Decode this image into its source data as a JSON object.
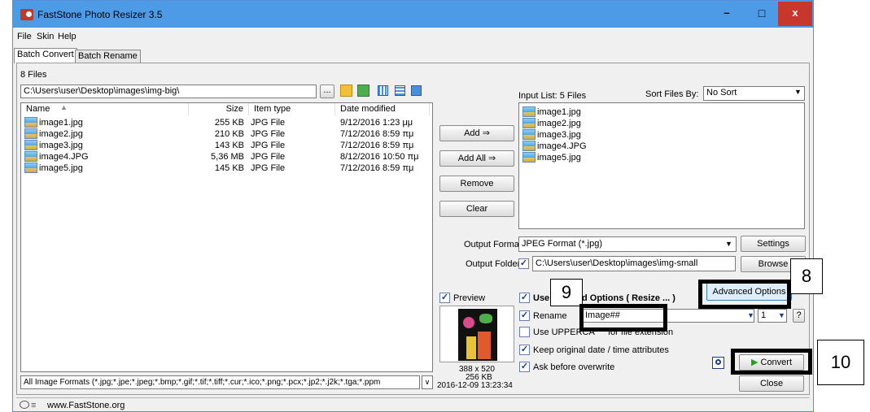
{
  "title": "FastStone Photo Resizer 3.5",
  "window_buttons": {
    "minimize": "–",
    "maximize": "□",
    "close": "x"
  },
  "menu": [
    "File",
    "Skin",
    "Help"
  ],
  "tabs": [
    "Batch Convert",
    "Batch Rename"
  ],
  "file_count": "8 Files",
  "path": "C:\\Users\\user\\Desktop\\images\\img-big\\",
  "browse_dots": "...",
  "columns": {
    "name": "Name",
    "size": "Size",
    "type": "Item type",
    "date": "Date modified"
  },
  "files": [
    {
      "name": "image1.jpg",
      "size": "255 KB",
      "type": "JPG File",
      "date": "9/12/2016 1:23 μμ"
    },
    {
      "name": "image2.jpg",
      "size": "210 KB",
      "type": "JPG File",
      "date": "7/12/2016 8:59 πμ"
    },
    {
      "name": "image3.jpg",
      "size": "143 KB",
      "type": "JPG File",
      "date": "7/12/2016 8:59 πμ"
    },
    {
      "name": "image4.JPG",
      "size": "5,36 MB",
      "type": "JPG File",
      "date": "8/12/2016 10:50 πμ"
    },
    {
      "name": "image5.jpg",
      "size": "145 KB",
      "type": "JPG File",
      "date": "7/12/2016 8:59 πμ"
    }
  ],
  "filter": "All Image Formats (*.jpg;*.jpe;*.jpeg;*.bmp;*.gif;*.tif;*.tiff;*.cur;*.ico;*.png;*.pcx;*.jp2;*.j2k;*.tga;*.ppm",
  "filter_arrow": "∨",
  "buttons": {
    "add": "Add ⇒",
    "add_all": "Add All ⇒",
    "remove": "Remove",
    "clear": "Clear",
    "settings": "Settings",
    "browse": "Browse",
    "advanced": "Advanced Options",
    "convert": "Convert",
    "close": "Close",
    "help": "?"
  },
  "input_list": {
    "label": "Input List: 5 Files",
    "sort_label": "Sort Files By:",
    "sort_value": "No Sort",
    "items": [
      "image1.jpg",
      "image2.jpg",
      "image3.jpg",
      "image4.JPG",
      "image5.jpg"
    ]
  },
  "output": {
    "format_label": "Output Format:",
    "format_value": "JPEG Format (*.jpg)",
    "folder_label": "Output Folder:",
    "folder_value": "C:\\Users\\user\\Desktop\\images\\img-small"
  },
  "preview": {
    "label": "Preview",
    "dimensions": "388 x 520",
    "filesize": "256 KB",
    "datetime": "2016-12-09 13:23:34"
  },
  "options": {
    "use_advanced_prefix": "Use",
    "use_advanced_suffix": "d Options ( Resize ... )",
    "rename": "Rename",
    "rename_value": "Image##",
    "rename_start": "1",
    "uppercase_prefix": "Use UPPERCA",
    "uppercase_suffix": "for file extension",
    "keep_date": "Keep original date / time attributes",
    "ask_overwrite": "Ask before overwrite"
  },
  "annotations": {
    "a8": "8",
    "a9": "9",
    "a10": "10"
  },
  "status": {
    "url": "www.FastStone.org"
  },
  "colors": {
    "titlebar": "#4d9ae6",
    "close": "#c8372c",
    "accent": "#1b3c8f"
  }
}
